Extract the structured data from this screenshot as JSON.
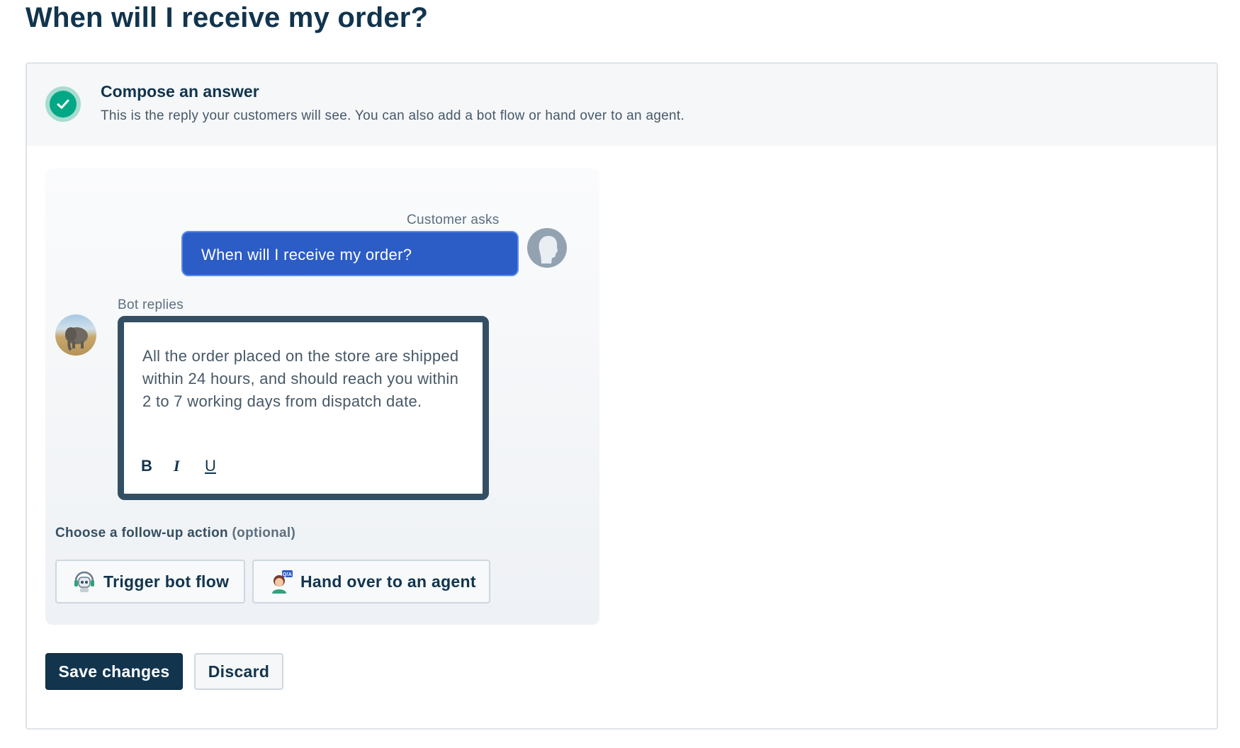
{
  "page": {
    "title": "When will I receive my order?"
  },
  "step": {
    "title": "Compose an answer",
    "description": "This is the reply your customers will see. You can also add a bot flow or hand over to an agent.",
    "status_icon": "check-circle-icon"
  },
  "preview": {
    "customer_label": "Customer asks",
    "customer_message": "When will I receive my order?",
    "bot_label": "Bot replies",
    "bot_message": "All the order placed on the store are shipped within 24 hours, and should reach you within 2 to 7 working days from dispatch date.",
    "formatting": {
      "bold": "B",
      "italic": "I",
      "underline": "U"
    }
  },
  "followup": {
    "label": "Choose a follow-up action",
    "optional": "(optional)",
    "actions": [
      {
        "label": "Trigger bot flow",
        "icon": "robot-headset-icon"
      },
      {
        "label": "Hand over to an agent",
        "icon": "agent-qa-icon"
      }
    ]
  },
  "footer": {
    "save_label": "Save changes",
    "discard_label": "Discard"
  },
  "colors": {
    "accent": "#12344d",
    "bubble": "#2c5cc5",
    "success": "#00a886"
  }
}
